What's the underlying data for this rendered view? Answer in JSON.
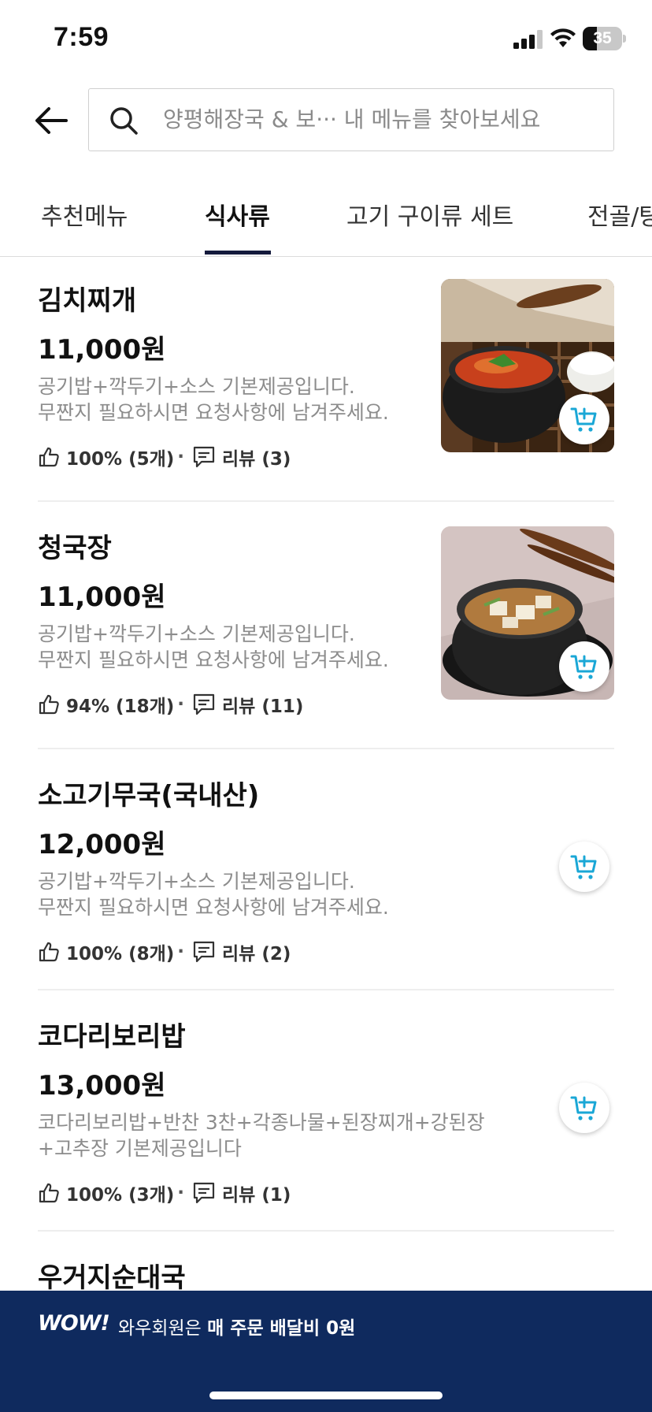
{
  "status_bar": {
    "time": "7:59",
    "battery_level": "35",
    "battery_fraction": 0.35
  },
  "search": {
    "text": "양평해장국 & 보···   내 메뉴를 찾아보세요"
  },
  "tabs": [
    {
      "label": "추천메뉴"
    },
    {
      "label": "식사류"
    },
    {
      "label": "고기 구이류 세트"
    },
    {
      "label": "전골/탕"
    }
  ],
  "menu": [
    {
      "name": "김치찌개",
      "price": "11,000원",
      "desc_line1": "공기밥+깍두기+소스 기본제공입니다.",
      "desc_line2": "무짠지 필요하시면 요청사항에 남겨주세요.",
      "rating": "100% (5개)",
      "reviews": "리뷰 (3)"
    },
    {
      "name": "청국장",
      "price": "11,000원",
      "desc_line1": "공기밥+깍두기+소스 기본제공입니다.",
      "desc_line2": "무짠지 필요하시면 요청사항에 남겨주세요.",
      "rating": "94% (18개)",
      "reviews": "리뷰 (11)"
    },
    {
      "name": "소고기무국(국내산)",
      "price": "12,000원",
      "desc_line1": "공기밥+깍두기+소스 기본제공입니다.",
      "desc_line2": "무짠지 필요하시면 요청사항에 남겨주세요.",
      "rating": "100% (8개)",
      "reviews": "리뷰 (2)"
    },
    {
      "name": "코다리보리밥",
      "price": "13,000원",
      "desc_line1": "코다리보리밥+반찬 3찬+각종나물+된장찌개+강된장",
      "desc_line2": "+고추장 기본제공입니다",
      "rating": "100% (3개)",
      "reviews": "리뷰 (1)"
    },
    {
      "name": "우거지순대국"
    }
  ],
  "banner": {
    "logo": "WOW!",
    "text_prefix": "와우회원은 ",
    "text_bold": "매 주문 배달비 0원"
  },
  "colors": {
    "accent_blue": "#1aa7d6",
    "banner_navy": "#0f2a5e",
    "tab_underline": "#141a3c"
  }
}
